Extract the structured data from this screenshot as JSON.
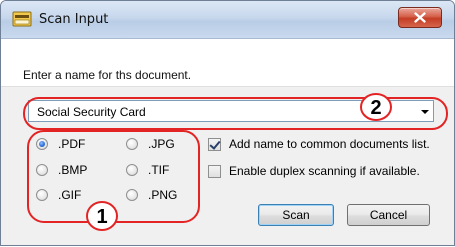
{
  "window": {
    "title": "Scan Input",
    "close_glyph": "✕"
  },
  "prompt": {
    "label": "Enter a name for ths document."
  },
  "name_combo": {
    "value": "Social Security Card"
  },
  "formats": {
    "selected": ".PDF",
    "options": [
      ".PDF",
      ".JPG",
      ".BMP",
      ".TIF",
      ".GIF",
      ".PNG"
    ]
  },
  "options": {
    "add_name": {
      "label": "Add name to common documents list.",
      "checked": true
    },
    "duplex": {
      "label": "Enable duplex scanning if available.",
      "checked": false
    }
  },
  "buttons": {
    "scan": "Scan",
    "cancel": "Cancel"
  },
  "callouts": {
    "one": "1",
    "two": "2",
    "color": "#e32424"
  },
  "colors": {
    "radio_selected": "#2a6ad6",
    "titlebar": "#c7d7ec",
    "close_button": "#c43d24"
  }
}
